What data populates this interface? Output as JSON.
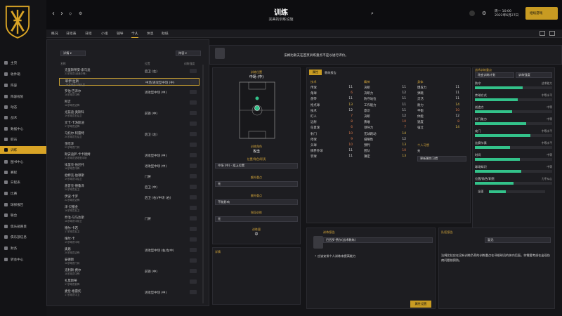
{
  "header": {
    "title": "训练",
    "subtitle": "完美的训练设施",
    "date_line1": "周一 10:00",
    "date_line2": "2022年6月27日",
    "continue_label": "继续游戏"
  },
  "tabs": [
    "概况",
    "日程表",
    "日程",
    "小组",
    "辅导",
    "个人",
    "休息",
    "助纸"
  ],
  "sidebar": [
    "主页",
    "收件箱",
    "阵容",
    "阵容规划",
    "动态",
    "战术",
    "数据中心",
    "职员",
    "训练",
    "图书中心",
    "赛程",
    "日程表",
    "比赛",
    "球探报告",
    "联合",
    "俱乐部愿景",
    "俱乐部信息",
    "财务",
    "转会中心"
  ],
  "list": {
    "filter_label": "详情",
    "view_label": "阵容",
    "col_name": "名称",
    "col_pos": "位置",
    "col_intensity": "训练强度"
  },
  "players": [
    {
      "name": "克里斯蒂安·索马迪",
      "sub": "23岁球员(创造中锋)",
      "pos": "后卫 (左)"
    },
    {
      "name": "耶伊·拉斯",
      "sub": "16岁球员中场队员",
      "pos": "中场/进攻型中场 (中)"
    },
    {
      "name": "罗伯·巴泽尔",
      "sub": "18岁球员中锋",
      "pos": "进攻型中场 (中)"
    },
    {
      "name": "阿吉",
      "sub": "16岁球员边锋",
      "pos": ""
    },
    {
      "name": "尤兹迪·奥斯科",
      "sub": "19岁球员右后卫",
      "pos": "前锋 (中)"
    },
    {
      "name": "文卡·卡洛斯迪",
      "sub": "17岁球员边锋",
      "pos": ""
    },
    {
      "name": "马托尔·阿雷特",
      "sub": "20岁球员左后卫",
      "pos": "后卫 (左)"
    },
    {
      "name": "金哈泽",
      "sub": "22岁球员门将",
      "pos": ""
    },
    {
      "name": "斯安迪萨·卡卡德姆",
      "sub": "21岁球员进攻型中场",
      "pos": "进攻型中场 (中)"
    },
    {
      "name": "埃里克·伯尼托",
      "sub": "18岁球员中锋",
      "pos": "进攻型中场 (中)"
    },
    {
      "name": "伯特克·伯顿斯",
      "sub": "19岁球员中后卫",
      "pos": "门将"
    },
    {
      "name": "盖普克·德鲁泽",
      "sub": "20岁球员后卫",
      "pos": "后卫 (中)"
    },
    {
      "name": "伊波·卡罗",
      "sub": "22岁球员边锋",
      "pos": "后卫 (右)/中场 (右)"
    },
    {
      "name": "泽·贝塞金",
      "sub": "16岁球员后卫",
      "pos": ""
    },
    {
      "name": "乔治·马马达斯",
      "sub": "18岁球员中前卫",
      "pos": "门将"
    },
    {
      "name": "德尔·卡若",
      "sub": "17岁球员后卫",
      "pos": ""
    },
    {
      "name": "维尔·卡",
      "sub": "19岁球员中场",
      "pos": ""
    },
    {
      "name": "奥恩",
      "sub": "20岁球员边锋",
      "pos": "进攻型中场 (右/左中)"
    },
    {
      "name": "安德斯",
      "sub": "16岁球员门将",
      "pos": ""
    },
    {
      "name": "克利斯·费尔",
      "sub": "18岁球员中锋",
      "pos": "前锋 (中)"
    },
    {
      "name": "扎莫斯蒂",
      "sub": "17岁球员前锋",
      "pos": ""
    },
    {
      "name": "麦伦·格雷托",
      "sub": "17岁球员中卫",
      "pos": "进攻型中场 (中)"
    }
  ],
  "selected_player": {
    "intro": "法姆比斯夫在首页训练重点不是以进行评价。"
  },
  "position_panel": {
    "label": "训练位置",
    "value": "中场 (中)",
    "role_label": "训练角色",
    "role_value": "攻击",
    "drop1": "中场 (中) - 组上位置",
    "attr_label": "额外重点",
    "drop2": "无",
    "trait_label": "额外重点",
    "drop3": "不能影响",
    "freq_label": "指导训练",
    "drop4": "无",
    "intensity_btn": "开启训练强度",
    "heading_label": "训练量",
    "heading_value": "中",
    "detail_label": "详情"
  },
  "attributes": {
    "tab1": "属性",
    "tab2": "教练报告",
    "head_tech": "技术",
    "head_mental": "精神",
    "head_phys": "身体",
    "tech": [
      [
        "传球",
        "11"
      ],
      [
        "角球",
        "6"
      ],
      [
        "盘带",
        "11"
      ],
      [
        "抢点球",
        "13"
      ],
      [
        "技术",
        "12"
      ],
      [
        "盯人",
        "7"
      ],
      [
        "远射",
        "8"
      ],
      [
        "任意球",
        "6"
      ],
      [
        "射门",
        "10"
      ],
      [
        "停球",
        "9"
      ],
      [
        "头球",
        "10"
      ],
      [
        "掷界外球",
        "11"
      ],
      [
        "罚球",
        "11"
      ]
    ],
    "mental": [
      [
        "决断",
        "11"
      ],
      [
        "决断力",
        "12"
      ],
      [
        "防守站位",
        "11"
      ],
      [
        "工作能力",
        "11"
      ],
      [
        "意识",
        "11"
      ],
      [
        "决断",
        "12"
      ],
      [
        "勇敢",
        "10"
      ],
      [
        "领导力",
        "7"
      ],
      [
        "无球跑动",
        "14"
      ],
      [
        "侵略性",
        "12"
      ],
      [
        "预判",
        "13"
      ],
      [
        "团队",
        "10"
      ],
      [
        "镇定",
        "13"
      ]
    ],
    "phys": [
      [
        "爆发力",
        "11"
      ],
      [
        "弹跳",
        "11"
      ],
      [
        "灵活",
        "11"
      ],
      [
        "耐力",
        "14"
      ],
      [
        "平衡",
        "10"
      ],
      [
        "体能",
        "12"
      ],
      [
        "速度",
        "8"
      ],
      [
        "强壮",
        "14"
      ]
    ],
    "reveal_label": "个人习惯",
    "reveal_value": "无",
    "drop": "更新属性习惯"
  },
  "right_panel": {
    "drop_a": "改变训练计划",
    "drop_b": "训练强度",
    "sections": [
      [
        "防守",
        "战术能力"
      ],
      [
        "传球方式",
        "中等水平"
      ],
      [
        "创造力",
        "中等"
      ],
      [
        "射门能力",
        "中等"
      ],
      [
        "攻门",
        "中等水平"
      ],
      [
        "比赛节奏",
        "中等水平"
      ],
      [
        "时间",
        "中等"
      ],
      [
        "球场知识",
        "中等"
      ],
      [
        "位置/角色/职责",
        "力不从心"
      ]
    ],
    "fill": [
      0.62,
      0.55,
      0.48,
      0.66,
      0.72,
      0.45,
      0.58,
      0.6,
      0.5
    ],
    "total_label": "全面"
  },
  "coach": {
    "title": "训练报告",
    "drop": "巴西罗·费尔(战术教练)",
    "bullet": "应该安排个人训练来提高能力",
    "btn": "属性设置"
  },
  "team": {
    "title": "队医报告",
    "drop": "暂无",
    "body": "法姆比拉应在没有训练负荷的训练重点在寻根球员的体内后面。你需要考虑在出现伤病问题前预防。"
  },
  "colors": {
    "accent": "#d9a426",
    "green": "#33c28a",
    "bg": "#151518"
  }
}
